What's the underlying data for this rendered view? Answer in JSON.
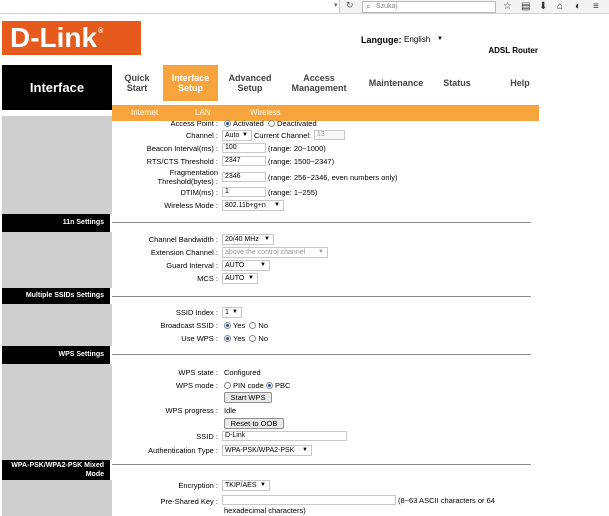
{
  "browser": {
    "search_placeholder": "Szukaj",
    "dropdown_glyph": "▾",
    "reload_glyph": "↻",
    "toolbar_icons": [
      "star-icon",
      "bookmarks-icon",
      "download-icon",
      "home-icon",
      "pocket-icon",
      "menu-icon"
    ]
  },
  "header": {
    "logo_text": "D-Link",
    "logo_mark": "®",
    "language_label": "Languge:",
    "language_value": "English",
    "product_name": "ADSL Router",
    "brand_color": "#e65a1e"
  },
  "nav": {
    "section_title": "Interface",
    "tabs": [
      {
        "line1": "Quick",
        "line2": "Start"
      },
      {
        "line1": "Interface",
        "line2": "Setup"
      },
      {
        "line1": "Advanced",
        "line2": "Setup"
      },
      {
        "line1": "Access",
        "line2": "Management"
      },
      {
        "line1": "Maintenance",
        "line2": ""
      },
      {
        "line1": "Status",
        "line2": ""
      },
      {
        "line1": "Help",
        "line2": ""
      }
    ],
    "subtabs": [
      "Internet",
      "LAN",
      "Wireless"
    ],
    "accent_color": "#f7a43d"
  },
  "wireless": {
    "access_point_label": "Access Point",
    "access_point_options": [
      "Activated",
      "Deactivated"
    ],
    "channel_label": "Channel",
    "channel_value": "Auto",
    "current_channel_label": "Current Channel:",
    "current_channel_value": "13",
    "beacon_label": "Beacon Interval(ms)",
    "beacon_value": "100",
    "beacon_range": "(range: 20~1000)",
    "rts_label": "RTS/CTS Threshold",
    "rts_value": "2347",
    "rts_range": "(range: 1500~2347)",
    "frag_label_1": "Fragmentation",
    "frag_label_2": "Threshold(bytes)",
    "frag_value": "2346",
    "frag_range": "(range: 256~2346, even numbers only)",
    "dtim_label": "DTIM(ms)",
    "dtim_value": "1",
    "dtim_range": "(range: 1~255)",
    "mode_label": "Wireless Mode",
    "mode_value": "802.11b+g+n"
  },
  "n11": {
    "section_title": "11n Settings",
    "bandwidth_label": "Channel Bandwidth",
    "bandwidth_value": "20/40 MHz",
    "ext_label": "Extension Channel",
    "ext_value": "above the control channel",
    "guard_label": "Guard Interval",
    "guard_value": "AUTO",
    "mcs_label": "MCS",
    "mcs_value": "AUTO"
  },
  "ssids": {
    "section_title": "Multiple SSIDs Settings",
    "index_label": "SSID Index",
    "index_value": "1",
    "broadcast_label": "Broadcast SSID",
    "wps_label": "Use WPS",
    "yes": "Yes",
    "no": "No"
  },
  "wps": {
    "section_title": "WPS Settings",
    "state_label": "WPS state",
    "state_value": "Configured",
    "mode_label": "WPS mode",
    "mode_pin": "PIN code",
    "mode_pbc": "PBC",
    "start_button": "Start WPS",
    "progress_label": "WPS progress",
    "progress_value": "Idle",
    "reset_button": "Reset to OOB",
    "ssid_label": "SSID",
    "ssid_value": "D-Link",
    "auth_label": "Authentication Type",
    "auth_value": "WPA-PSK/WPA2-PSK"
  },
  "wpa": {
    "section_title_1": "WPA-PSK/WPA2-PSK Mixed",
    "section_title_2": "Mode",
    "encryption_label": "Encryption",
    "encryption_value": "TKIP/AES",
    "psk_label": "Pre-Shared Key",
    "psk_value": "",
    "psk_hint_1": "(8~63 ASCII characters or 64",
    "psk_hint_2": "hexadecimal characters)"
  },
  "colon": ":"
}
